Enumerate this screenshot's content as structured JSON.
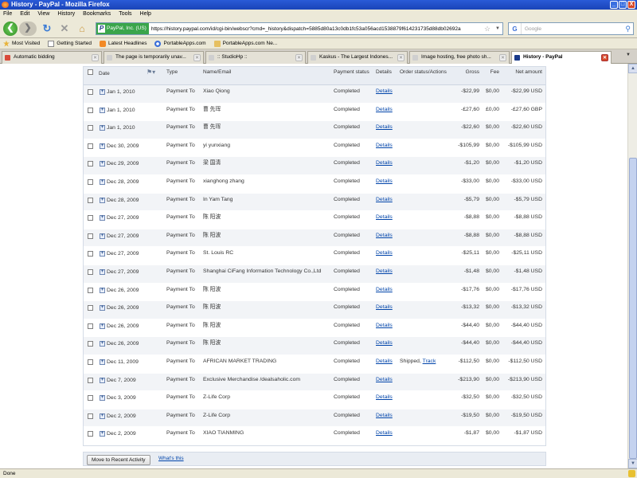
{
  "window": {
    "title": "History - PayPal - Mozilla Firefox",
    "min": "_",
    "max": "□",
    "close": "X"
  },
  "menu": [
    "File",
    "Edit",
    "View",
    "History",
    "Bookmarks",
    "Tools",
    "Help"
  ],
  "nav": {
    "identity": "PayPal, Inc. (US)",
    "identity_mark": "P",
    "url": "https://history.paypal.com/id/cgi-bin/webscr?cmd=_history&dispatch=5885d80a13c0db1fc53a056acd1538879f614231735d88db02692a",
    "search_placeholder": "Google",
    "search_logo": "G"
  },
  "bookmarks": [
    {
      "label": "Most Visited",
      "icon": "star-icon"
    },
    {
      "label": "Getting Started",
      "icon": "page-icon"
    },
    {
      "label": "Latest Headlines",
      "icon": "rss-icon"
    },
    {
      "label": "PortableApps.com",
      "icon": "portableapps-icon"
    },
    {
      "label": "PortableApps.com Ne...",
      "icon": "folder-icon"
    }
  ],
  "tabs": [
    {
      "label": "Automatic bidding",
      "color": "#d94a3a"
    },
    {
      "label": "The page is temporarily unav...",
      "color": "#cfcfcf"
    },
    {
      "label": ":: StudioHp ::",
      "color": "#cfcfcf"
    },
    {
      "label": "Kaskus - The Largest Indones...",
      "color": "#cfcfcf"
    },
    {
      "label": "Image hosting, free photo sh...",
      "color": "#cfcfcf"
    },
    {
      "label": "History - PayPal",
      "color": "#1a3a8a",
      "active": true
    }
  ],
  "table": {
    "headers": {
      "date": "Date",
      "type": "Type",
      "name": "Name/Email",
      "status": "Payment status",
      "details": "Details",
      "order": "Order status/Actions",
      "gross": "Gross",
      "fee": "Fee",
      "net": "Net amount"
    },
    "rows": [
      {
        "date": "Jan 1, 2010",
        "type": "Payment To",
        "name": "Xiao Qiong",
        "status": "Completed",
        "details": "Details",
        "order": "",
        "track": "",
        "gross": "-$22,99",
        "fee": "$0,00",
        "net": "-$22,99 USD"
      },
      {
        "date": "Jan 1, 2010",
        "type": "Payment To",
        "name": "曹 先珲",
        "status": "Completed",
        "details": "Details",
        "order": "",
        "track": "",
        "gross": "-£27,60",
        "fee": "£0,00",
        "net": "-£27,60 GBP"
      },
      {
        "date": "Jan 1, 2010",
        "type": "Payment To",
        "name": "曹 先珲",
        "status": "Completed",
        "details": "Details",
        "order": "",
        "track": "",
        "gross": "-$22,60",
        "fee": "$0,00",
        "net": "-$22,60 USD"
      },
      {
        "date": "Dec 30, 2009",
        "type": "Payment To",
        "name": "yi yunxiang",
        "status": "Completed",
        "details": "Details",
        "order": "",
        "track": "",
        "gross": "-$105,99",
        "fee": "$0,00",
        "net": "-$105,99 USD"
      },
      {
        "date": "Dec 29, 2009",
        "type": "Payment To",
        "name": "梁 国清",
        "status": "Completed",
        "details": "Details",
        "order": "",
        "track": "",
        "gross": "-$1,20",
        "fee": "$0,00",
        "net": "-$1,20 USD"
      },
      {
        "date": "Dec 28, 2009",
        "type": "Payment To",
        "name": "xianghong zhang",
        "status": "Completed",
        "details": "Details",
        "order": "",
        "track": "",
        "gross": "-$33,00",
        "fee": "$0,00",
        "net": "-$33,00 USD"
      },
      {
        "date": "Dec 28, 2009",
        "type": "Payment To",
        "name": "In Yam Tang",
        "status": "Completed",
        "details": "Details",
        "order": "",
        "track": "",
        "gross": "-$5,79",
        "fee": "$0,00",
        "net": "-$5,79 USD"
      },
      {
        "date": "Dec 27, 2009",
        "type": "Payment To",
        "name": "陈 阳波",
        "status": "Completed",
        "details": "Details",
        "order": "",
        "track": "",
        "gross": "-$8,88",
        "fee": "$0,00",
        "net": "-$8,88 USD"
      },
      {
        "date": "Dec 27, 2009",
        "type": "Payment To",
        "name": "陈 阳波",
        "status": "Completed",
        "details": "Details",
        "order": "",
        "track": "",
        "gross": "-$8,88",
        "fee": "$0,00",
        "net": "-$8,88 USD"
      },
      {
        "date": "Dec 27, 2009",
        "type": "Payment To",
        "name": "St. Louis RC",
        "status": "Completed",
        "details": "Details",
        "order": "",
        "track": "",
        "gross": "-$25,11",
        "fee": "$0,00",
        "net": "-$25,11 USD"
      },
      {
        "date": "Dec 27, 2009",
        "type": "Payment To",
        "name": "Shanghai CiFang Information Technology Co.,Ltd",
        "status": "Completed",
        "details": "Details",
        "order": "",
        "track": "",
        "gross": "-$1,48",
        "fee": "$0,00",
        "net": "-$1,48 USD"
      },
      {
        "date": "Dec 26, 2009",
        "type": "Payment To",
        "name": "陈 阳波",
        "status": "Completed",
        "details": "Details",
        "order": "",
        "track": "",
        "gross": "-$17,76",
        "fee": "$0,00",
        "net": "-$17,76 USD"
      },
      {
        "date": "Dec 26, 2009",
        "type": "Payment To",
        "name": "陈 阳波",
        "status": "Completed",
        "details": "Details",
        "order": "",
        "track": "",
        "gross": "-$13,32",
        "fee": "$0,00",
        "net": "-$13,32 USD"
      },
      {
        "date": "Dec 26, 2009",
        "type": "Payment To",
        "name": "陈 阳波",
        "status": "Completed",
        "details": "Details",
        "order": "",
        "track": "",
        "gross": "-$44,40",
        "fee": "$0,00",
        "net": "-$44,40 USD"
      },
      {
        "date": "Dec 26, 2009",
        "type": "Payment To",
        "name": "陈 阳波",
        "status": "Completed",
        "details": "Details",
        "order": "",
        "track": "",
        "gross": "-$44,40",
        "fee": "$0,00",
        "net": "-$44,40 USD"
      },
      {
        "date": "Dec 11, 2009",
        "type": "Payment To",
        "name": "AFRICAN MARKET TRADING",
        "status": "Completed",
        "details": "Details",
        "order": "Shipped,",
        "track": "Track",
        "gross": "-$112,50",
        "fee": "$0,00",
        "net": "-$112,50 USD"
      },
      {
        "date": "Dec 7, 2009",
        "type": "Payment To",
        "name": "Exclusive Merchandise /dealsaholic.com",
        "status": "Completed",
        "details": "Details",
        "order": "",
        "track": "",
        "gross": "-$213,90",
        "fee": "$0,00",
        "net": "-$213,90 USD"
      },
      {
        "date": "Dec 3, 2009",
        "type": "Payment To",
        "name": "Z-Life Corp",
        "status": "Completed",
        "details": "Details",
        "order": "",
        "track": "",
        "gross": "-$32,50",
        "fee": "$0,00",
        "net": "-$32,50 USD"
      },
      {
        "date": "Dec 2, 2009",
        "type": "Payment To",
        "name": "Z-Life Corp",
        "status": "Completed",
        "details": "Details",
        "order": "",
        "track": "",
        "gross": "-$19,50",
        "fee": "$0,00",
        "net": "-$19,50 USD"
      },
      {
        "date": "Dec 2, 2009",
        "type": "Payment To",
        "name": "XIAO TIANMING",
        "status": "Completed",
        "details": "Details",
        "order": "",
        "track": "",
        "gross": "-$1,87",
        "fee": "$0,00",
        "net": "-$1,87 USD"
      }
    ]
  },
  "footer": {
    "move_button": "Move to Recent Activity",
    "whats_this": "What's this"
  },
  "status": "Done"
}
